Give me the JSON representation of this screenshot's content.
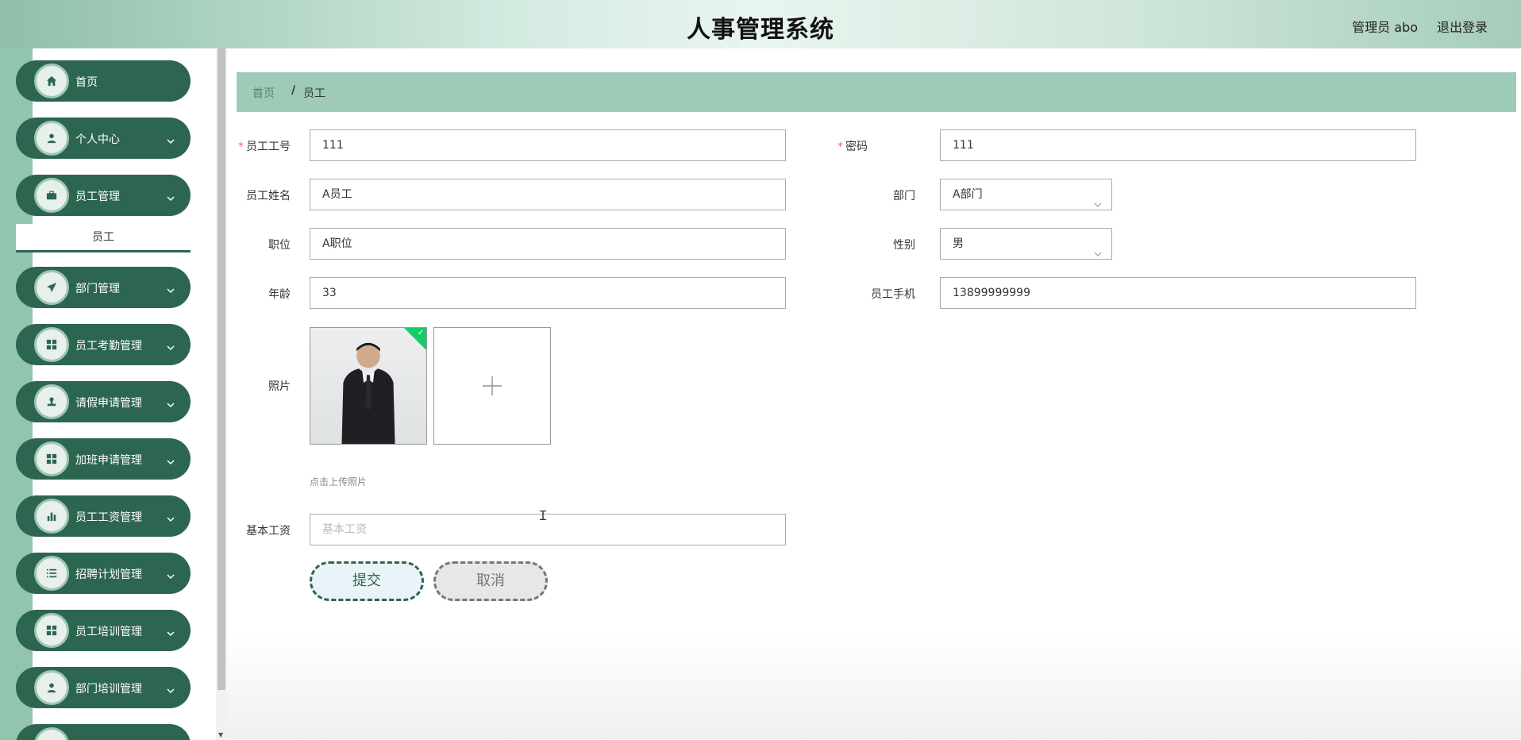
{
  "header": {
    "title": "人事管理系统",
    "user": "管理员 abo",
    "logout": "退出登录"
  },
  "sidebar": {
    "items": [
      {
        "label": "首页",
        "icon": "home-icon"
      },
      {
        "label": "个人中心",
        "icon": "user-icon"
      },
      {
        "label": "员工管理",
        "icon": "briefcase-icon"
      },
      {
        "label": "部门管理",
        "icon": "send-icon"
      },
      {
        "label": "员工考勤管理",
        "icon": "grid-icon"
      },
      {
        "label": "请假申请管理",
        "icon": "stamp-icon"
      },
      {
        "label": "加班申请管理",
        "icon": "grid-icon"
      },
      {
        "label": "员工工资管理",
        "icon": "bar-chart-icon"
      },
      {
        "label": "招聘计划管理",
        "icon": "list-icon"
      },
      {
        "label": "员工培训管理",
        "icon": "grid-icon"
      },
      {
        "label": "部门培训管理",
        "icon": "user-icon"
      }
    ],
    "submenu": {
      "label": "员工"
    }
  },
  "breadcrumb": {
    "home": "首页",
    "separator": "/",
    "current": "员工"
  },
  "form": {
    "employee_no": {
      "label": "员工工号",
      "value": "111"
    },
    "password": {
      "label": "密码",
      "value": "111"
    },
    "employee_name": {
      "label": "员工姓名",
      "value": "A员工"
    },
    "department": {
      "label": "部门",
      "value": "A部门"
    },
    "position": {
      "label": "职位",
      "value": "A职位"
    },
    "gender": {
      "label": "性别",
      "value": "男"
    },
    "age": {
      "label": "年龄",
      "value": "33"
    },
    "phone": {
      "label": "员工手机",
      "value": "13899999999"
    },
    "photo": {
      "label": "照片",
      "tip": "点击上传照片"
    },
    "base_salary": {
      "label": "基本工资",
      "placeholder": "基本工资",
      "value": ""
    },
    "submit": "提交",
    "cancel": "取消"
  },
  "colors": {
    "primary": "#2d6650",
    "breadcrumb_bg": "#9ecbb7",
    "required": "#f56c6c",
    "upload_success": "#13ce66"
  }
}
